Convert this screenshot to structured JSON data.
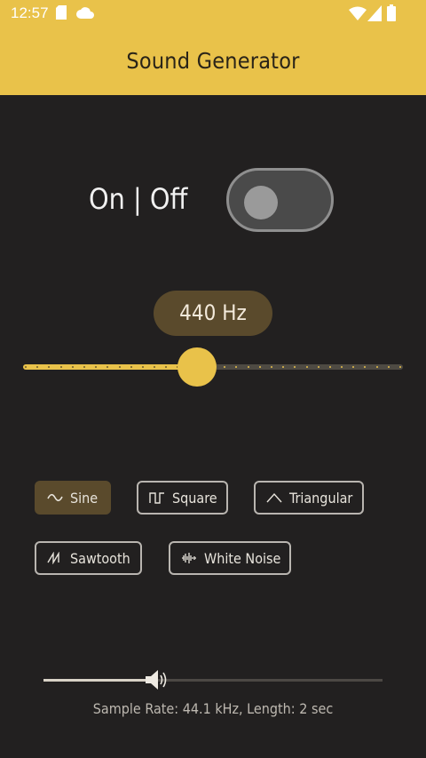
{
  "status_bar": {
    "time": "12:57",
    "icons": [
      "sd-card-icon",
      "cloud-icon",
      "wifi-icon",
      "signal-icon",
      "battery-icon"
    ]
  },
  "app_bar": {
    "title": "Sound Generator"
  },
  "power": {
    "label": "On | Off",
    "state": "off"
  },
  "frequency": {
    "display": "440 Hz",
    "slider_fraction": 0.46
  },
  "waveforms": [
    {
      "label": "Sine",
      "icon": "sine-wave-icon",
      "selected": true
    },
    {
      "label": "Square",
      "icon": "square-wave-icon",
      "selected": false
    },
    {
      "label": "Triangular",
      "icon": "triangle-wave-icon",
      "selected": false
    },
    {
      "label": "Sawtooth",
      "icon": "sawtooth-wave-icon",
      "selected": false
    },
    {
      "label": "White Noise",
      "icon": "noise-wave-icon",
      "selected": false
    }
  ],
  "volume": {
    "fraction": 0.33,
    "icon": "speaker-icon"
  },
  "footer": {
    "info": "Sample Rate: 44.1 kHz, Length: 2 sec"
  },
  "colors": {
    "accent": "#e9c24a",
    "background": "#222020",
    "selected_button": "#5a4a2c",
    "outline": "#b9b5b0"
  }
}
